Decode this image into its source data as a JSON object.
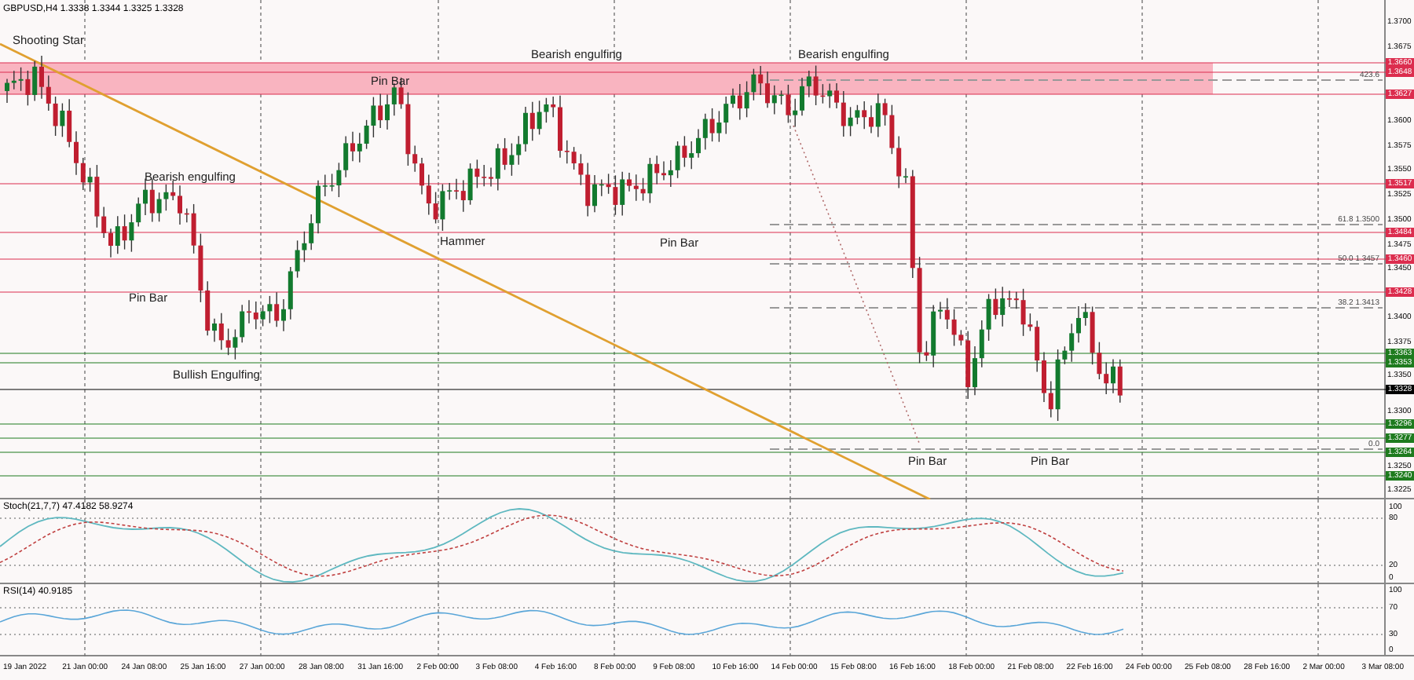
{
  "header": "GBPUSD,H4  1.3338 1.3344 1.3325 1.3328",
  "annotations": [
    "Shooting Star",
    "Pin Bar",
    "Bearish engulfing",
    "Bearish engulfing",
    "Bearish engulfing",
    "Hammer",
    "Pin Bar",
    "Pin Bar",
    "Bullish Engulfing",
    "Pin Bar",
    "Pin Bar"
  ],
  "fib_labels": [
    "423.6",
    "61.8 1.3500",
    "50.0 1.3457",
    "38.2 1.3413",
    "0.0"
  ],
  "price_ticks": [
    "1.3700",
    "1.3675",
    "1.3600",
    "1.3575",
    "1.3550",
    "1.3525",
    "1.3500",
    "1.3475",
    "1.3450",
    "1.3400",
    "1.3375",
    "1.3350",
    "1.3300",
    "1.3250",
    "1.3225"
  ],
  "price_levels": [
    {
      "value": "1.3660",
      "color": "#dc2d4e"
    },
    {
      "value": "1.3648",
      "color": "#dc2d4e"
    },
    {
      "value": "1.3627",
      "color": "#dc2d4e"
    },
    {
      "value": "1.3517",
      "color": "#dc2d4e"
    },
    {
      "value": "1.3484",
      "color": "#dc2d4e"
    },
    {
      "value": "1.3460",
      "color": "#dc2d4e"
    },
    {
      "value": "1.3428",
      "color": "#dc2d4e"
    },
    {
      "value": "1.3363",
      "color": "#1e7b1e"
    },
    {
      "value": "1.3353",
      "color": "#1e7b1e"
    },
    {
      "value": "1.3328",
      "color": "#000000"
    },
    {
      "value": "1.3296",
      "color": "#1e7b1e"
    },
    {
      "value": "1.3277",
      "color": "#1e7b1e"
    },
    {
      "value": "1.3264",
      "color": "#1e7b1e"
    },
    {
      "value": "1.3240",
      "color": "#1e7b1e"
    }
  ],
  "stoch": {
    "label": "Stoch(21,7,7) 47.4182 58.9274",
    "ticks": [
      "100",
      "80",
      "20",
      "0"
    ]
  },
  "rsi": {
    "label": "RSI(14) 40.9185",
    "ticks": [
      "100",
      "70",
      "30",
      "0"
    ]
  },
  "date_labels": [
    "19 Jan 2022",
    "21 Jan 00:00",
    "24 Jan 08:00",
    "25 Jan 16:00",
    "27 Jan 00:00",
    "28 Jan 08:00",
    "31 Jan 16:00",
    "2 Feb 00:00",
    "3 Feb 08:00",
    "4 Feb 16:00",
    "8 Feb 00:00",
    "9 Feb 08:00",
    "10 Feb 16:00",
    "14 Feb 00:00",
    "15 Feb 08:00",
    "16 Feb 16:00",
    "18 Feb 00:00",
    "21 Feb 08:00",
    "22 Feb 16:00",
    "24 Feb 00:00",
    "25 Feb 08:00",
    "28 Feb 16:00",
    "2 Mar 00:00",
    "3 Mar 08:00"
  ]
}
